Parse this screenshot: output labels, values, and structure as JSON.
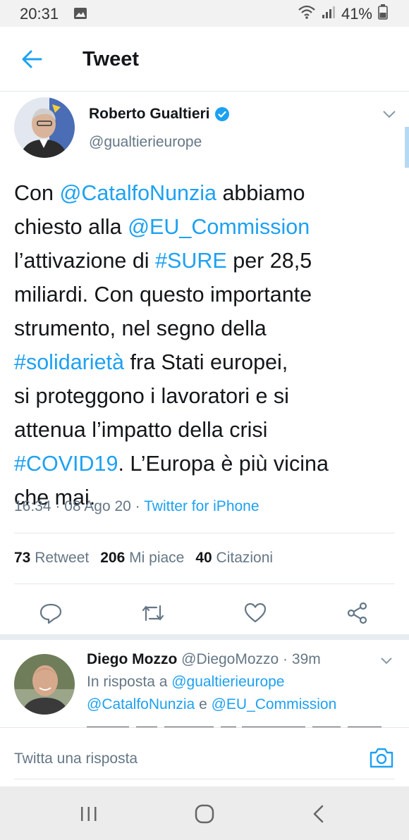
{
  "status_bar": {
    "time": "20:31",
    "battery": "41%"
  },
  "header": {
    "title": "Tweet"
  },
  "tweet": {
    "author_name": "Roberto Gualtieri",
    "author_handle": "@gualtierieurope",
    "text_lines": [
      [
        {
          "t": "Con "
        },
        {
          "t": "@CatalfoNunzia",
          "link": true
        },
        {
          "t": " abbiamo"
        }
      ],
      [
        {
          "t": "chiesto alla "
        },
        {
          "t": "@EU_Commission",
          "link": true
        }
      ],
      [
        {
          "t": "l’attivazione di "
        },
        {
          "t": "#SURE",
          "link": true
        },
        {
          "t": " per 28,5"
        }
      ],
      [
        {
          "t": "miliardi. Con questo importante"
        }
      ],
      [
        {
          "t": "strumento, nel segno della"
        }
      ],
      [
        {
          "t": "#solidarietà",
          "link": true
        },
        {
          "t": " fra Stati europei,"
        }
      ],
      [
        {
          "t": "si proteggono i lavoratori e si"
        }
      ],
      [
        {
          "t": "attenua l’impatto della crisi"
        }
      ],
      [
        {
          "t": "#COVID19",
          "link": true
        },
        {
          "t": ". L’Europa è più vicina"
        }
      ],
      [
        {
          "t": "che mai."
        }
      ]
    ],
    "meta": {
      "time": "16:34",
      "date": "08 Ago 20",
      "separator": " · ",
      "source": "Twitter for iPhone"
    },
    "stats": {
      "retweets": {
        "count": "73",
        "label": "Retweet"
      },
      "likes": {
        "count": "206",
        "label": "Mi piace"
      },
      "quotes": {
        "count": "40",
        "label": "Citazioni"
      }
    }
  },
  "reply": {
    "name": "Diego Mozzo",
    "handle": "@DiegoMozzo",
    "age": "39m",
    "in_reply_prefix": "In risposta a ",
    "in_reply_user1": "@gualtierieurope",
    "in_reply_user2": "@CatalfoNunzia",
    "in_reply_and": " e ",
    "in_reply_user3": "@EU_Commission"
  },
  "compose": {
    "placeholder": "Twitta una risposta"
  },
  "colors": {
    "accent": "#1da1f2",
    "muted": "#657786",
    "text": "#14171a",
    "divider": "#e1e8ed"
  }
}
